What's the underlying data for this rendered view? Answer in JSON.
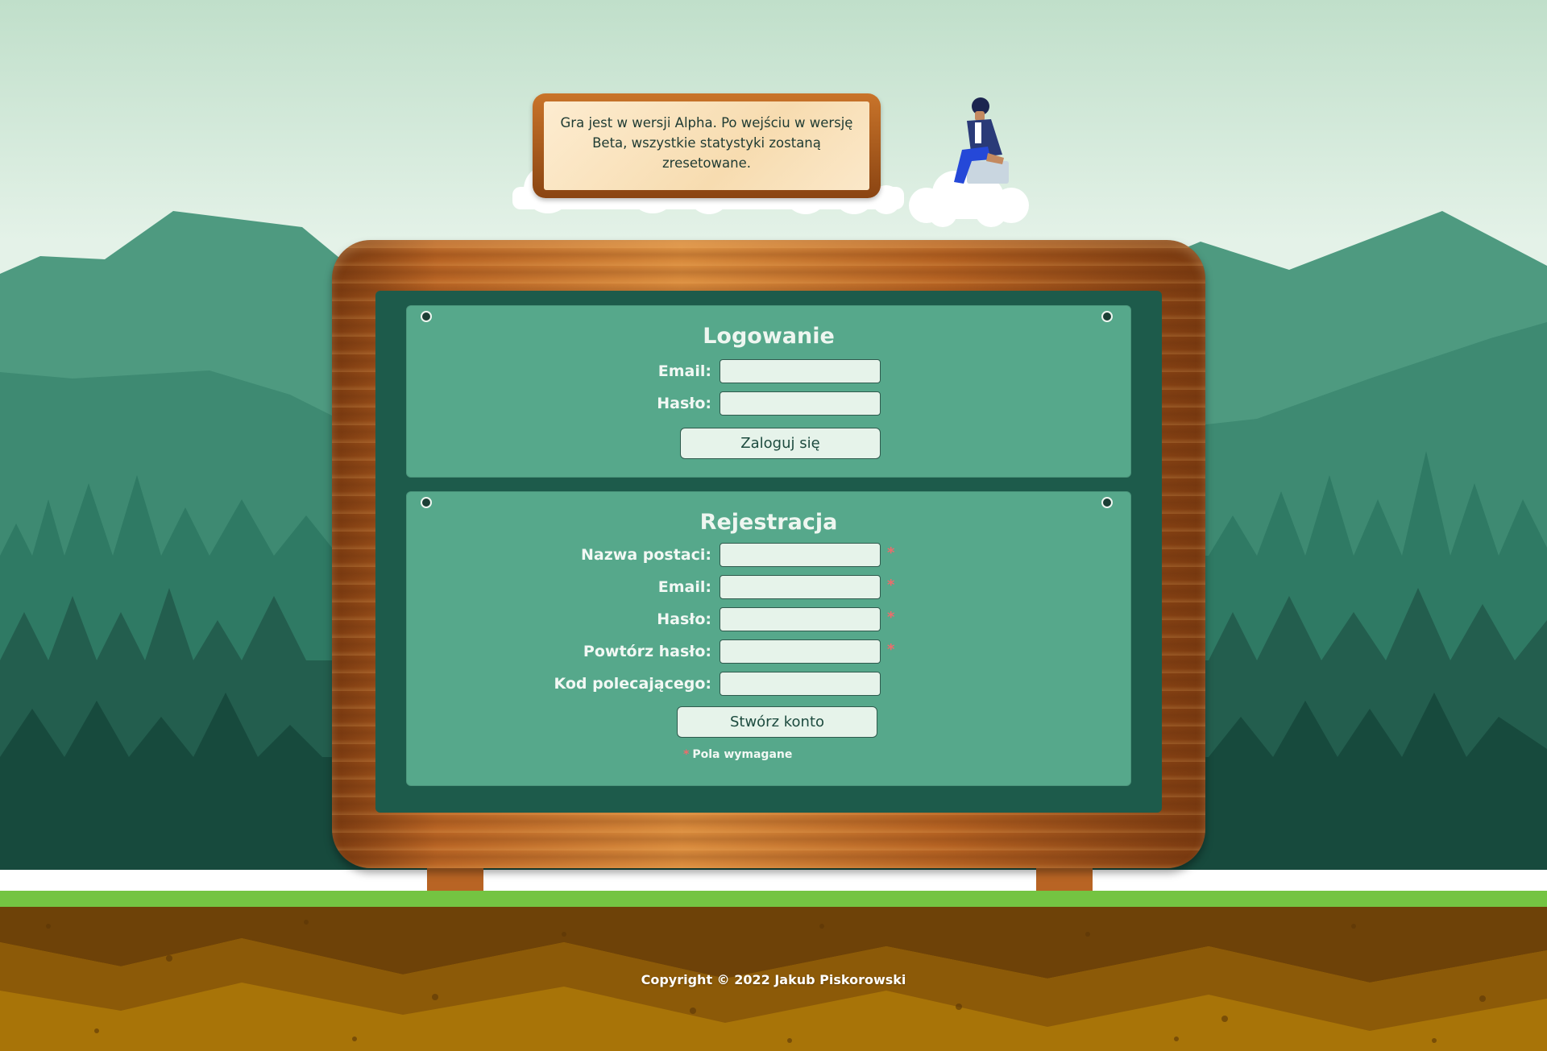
{
  "notice": {
    "text": "Gra jest w wersji Alpha. Po wejściu w wersję Beta, wszystkie statystyki zostaną zresetowane."
  },
  "login": {
    "title": "Logowanie",
    "email_label": "Email:",
    "password_label": "Hasło:",
    "submit_label": "Zaloguj się"
  },
  "register": {
    "title": "Rejestracja",
    "fields": [
      {
        "label": "Nazwa postaci:",
        "required_mark": "*"
      },
      {
        "label": "Email:",
        "required_mark": "*"
      },
      {
        "label": "Hasło:",
        "required_mark": "*"
      },
      {
        "label": "Powtórz hasło:",
        "required_mark": "*"
      },
      {
        "label": "Kod polecającego:",
        "required_mark": ""
      }
    ],
    "submit_label": "Stwórz konto",
    "required_note_mark": "*",
    "required_note": "Pola wymagane"
  },
  "footer": {
    "copyright": "Copyright © 2022 Jakub Piskorowski"
  },
  "colors": {
    "board_green": "#1d5b4b",
    "panel_green": "#56a88b",
    "required_red": "#ef6b6b",
    "input_bg": "#e6f3ea"
  },
  "icons": [
    "cloud-icon",
    "person-sitting-illustration",
    "screw-icon",
    "mountains-illustration",
    "forest-illustration",
    "soil-illustration"
  ]
}
